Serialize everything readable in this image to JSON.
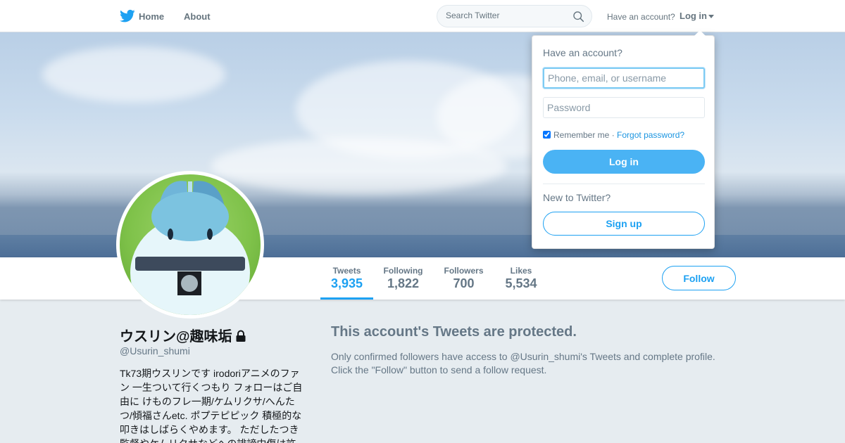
{
  "nav": {
    "home_label": "Home",
    "about_label": "About",
    "search_placeholder": "Search Twitter",
    "have_account_label": "Have an account?",
    "login_label": "Log in"
  },
  "profile": {
    "name": "ウスリン@趣味垢",
    "handle": "@Usurin_shumi",
    "bio": "Tk73期ウスリンです irodoriアニメのファン 一生ついて行くつもり フォローはご自由に けものフレ一期/ケムリクサ/へんたつ/傾福さんetc. ポプテピピック 積極的な叩きはしばらくやめます。 ただしたつき監督やケムリクサなどへの誹謗中傷は許しません",
    "follow_label": "Follow"
  },
  "stats": [
    {
      "label": "Tweets",
      "value": "3,935",
      "active": true
    },
    {
      "label": "Following",
      "value": "1,822",
      "active": false
    },
    {
      "label": "Followers",
      "value": "700",
      "active": false
    },
    {
      "label": "Likes",
      "value": "5,534",
      "active": false
    }
  ],
  "protected": {
    "title": "This account's Tweets are protected.",
    "line1": "Only confirmed followers have access to @Usurin_shumi's Tweets and complete profile.",
    "line2": "Click the \"Follow\" button to send a follow request."
  },
  "login_dropdown": {
    "title": "Have an account?",
    "username_placeholder": "Phone, email, or username",
    "password_placeholder": "Password",
    "remember_label": "Remember me",
    "separator": "·",
    "forgot_label": "Forgot password?",
    "login_button": "Log in",
    "new_label": "New to Twitter?",
    "signup_button": "Sign up"
  },
  "colors": {
    "accent": "#1da1f2",
    "login_button": "#4ab3f4",
    "muted_text": "#657786",
    "page_background": "#e6ecf0"
  },
  "icons": [
    "twitter-bird-icon",
    "search-icon",
    "caret-down-icon",
    "lock-icon"
  ]
}
